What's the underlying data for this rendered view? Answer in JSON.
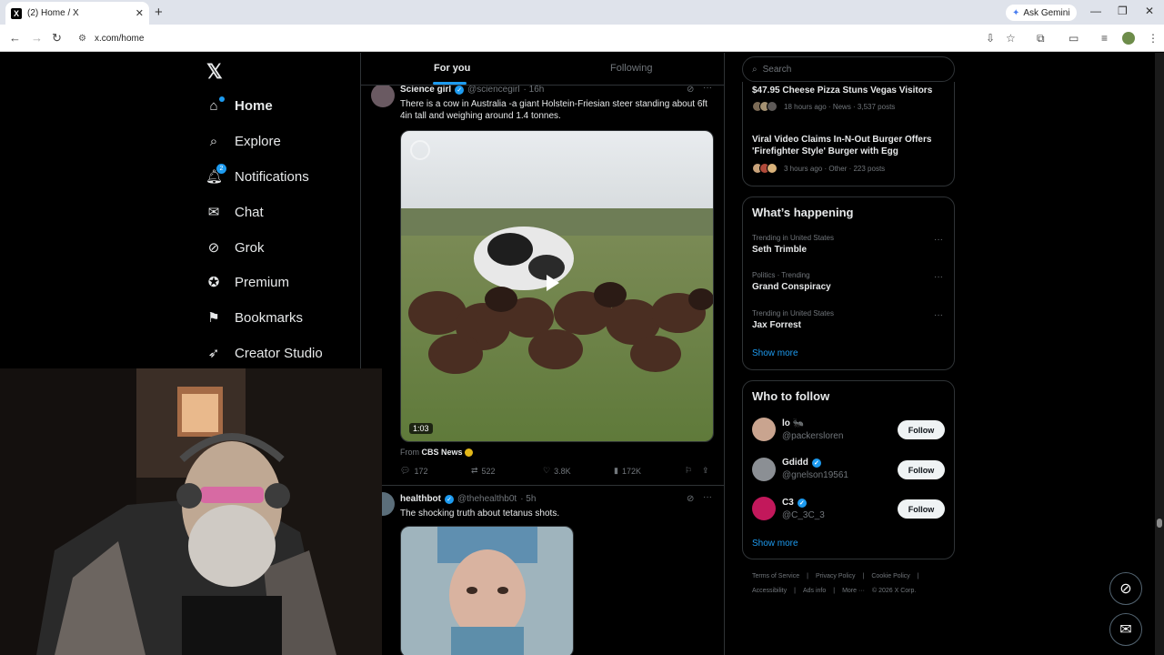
{
  "browser": {
    "tab_title": "(2) Home / X",
    "tab_favicon": "X",
    "url": "x.com/home",
    "ask_gemini": "Ask Gemini"
  },
  "nav": {
    "items": [
      {
        "label": "Home",
        "icon": "home-icon"
      },
      {
        "label": "Explore",
        "icon": "search-icon"
      },
      {
        "label": "Notifications",
        "icon": "bell-icon",
        "badge": "2"
      },
      {
        "label": "Chat",
        "icon": "mail-icon"
      },
      {
        "label": "Grok",
        "icon": "grok-icon"
      },
      {
        "label": "Premium",
        "icon": "premium-icon"
      },
      {
        "label": "Bookmarks",
        "icon": "bookmark-icon"
      },
      {
        "label": "Creator Studio",
        "icon": "rocket-icon"
      }
    ]
  },
  "feed": {
    "tabs": [
      "For you",
      "Following"
    ],
    "posts": [
      {
        "name": "Science girl",
        "handle": "@sciencegirl",
        "time": "· 16h",
        "text": "There is a cow in Australia -a giant Holstein-Friesian steer standing about 6ft 4in tall and weighing around 1.4 tonnes.",
        "duration": "1:03",
        "from_prefix": "From",
        "from_source": "CBS News",
        "replies": "172",
        "reposts": "522",
        "likes": "3.8K",
        "views": "172K"
      },
      {
        "name": "healthbot",
        "handle": "@thehealthb0t",
        "time": "· 5h",
        "text": "The shocking truth about tetanus shots."
      }
    ]
  },
  "right": {
    "search_placeholder": "Search",
    "news": [
      {
        "title": "$47.95 Cheese Pizza Stuns Vegas Visitors",
        "meta": "18 hours ago · News · 3,537 posts"
      },
      {
        "title": "Viral Video Claims In-N-Out Burger Offers 'Firefighter Style' Burger with Egg",
        "meta": "3 hours ago · Other · 223 posts"
      }
    ],
    "happening": {
      "title": "What’s happening",
      "trends": [
        {
          "meta": "Trending in United States",
          "name": "Seth Trimble"
        },
        {
          "meta": "Politics · Trending",
          "name": "Grand Conspiracy"
        },
        {
          "meta": "Trending in United States",
          "name": "Jax Forrest"
        }
      ],
      "show_more": "Show more"
    },
    "who_to_follow": {
      "title": "Who to follow",
      "users": [
        {
          "name": "lo 🐜",
          "handle": "@packersloren",
          "follow": "Follow",
          "color": "#c9a48f"
        },
        {
          "name": "Gdidd",
          "handle": "@gnelson19561",
          "follow": "Follow",
          "color": "#8b8f94"
        },
        {
          "name": "C3",
          "handle": "@C_3C_3",
          "follow": "Follow",
          "color": "#c2185b"
        }
      ],
      "show_more": "Show more"
    },
    "footer": {
      "line1": [
        "Terms of Service",
        "|",
        "Privacy Policy",
        "|",
        "Cookie Policy",
        "|"
      ],
      "line2": [
        "Accessibility",
        "|",
        "Ads info",
        "|",
        "More ···",
        "© 2026 X Corp."
      ]
    }
  },
  "colors": {
    "accent": "#1d9bf0",
    "background": "#000000",
    "border": "#2f3336",
    "muted": "#71767b"
  }
}
